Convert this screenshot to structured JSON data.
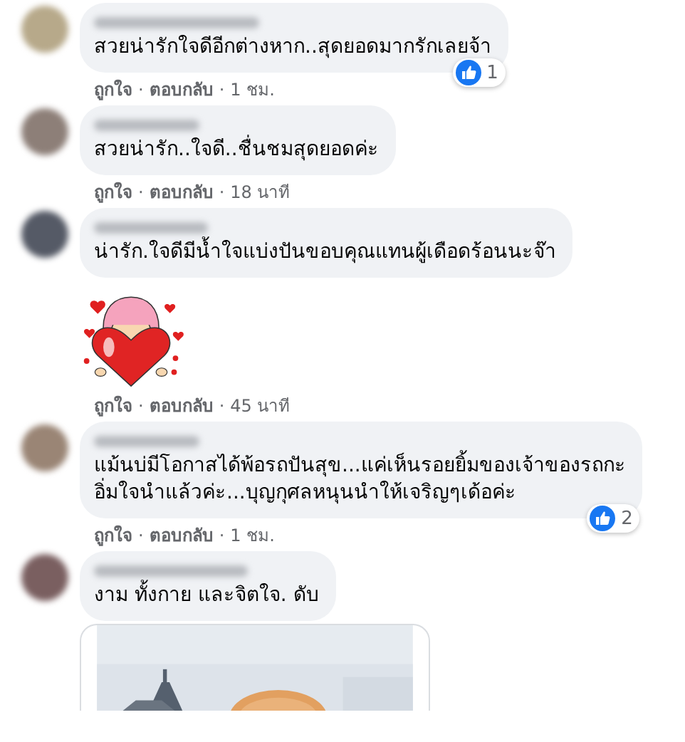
{
  "separator": "·",
  "comments": [
    {
      "text": "สวยน่ารักใจดีอีกต่างหาก..สุดยอดมากรักเลยจ้า",
      "reaction_count": "1",
      "like": "ถูกใจ",
      "reply": "ตอบกลับ",
      "time": "1 ชม."
    },
    {
      "text": "สวยน่ารัก..ใจดี..ชื่นชมสุดยอดค่ะ",
      "like": "ถูกใจ",
      "reply": "ตอบกลับ",
      "time": "18 นาที"
    },
    {
      "text": "น่ารัก.ใจดีมีน้ำใจแบ่งปันขอบคุณแทนผู้เดือดร้อนนะจ๊า",
      "attachment": {
        "kind": "sticker"
      },
      "like": "ถูกใจ",
      "reply": "ตอบกลับ",
      "time": "45 นาที"
    },
    {
      "text": "แม้นบ่มีโอกาสได้พ้อรถปันสุข...แค่เห็นรอยยิ้มของเจ้าของรถกะ\nอิ่มใจนำแล้วค่ะ...บุญกุศลหนุนนำให้เจริญๆเด้อค่ะ",
      "reaction_count": "2",
      "like": "ถูกใจ",
      "reply": "ตอบกลับ",
      "time": "1 ชม."
    },
    {
      "text": "งาม ทั้งกาย และจิตใจ. ดับ"
    }
  ]
}
